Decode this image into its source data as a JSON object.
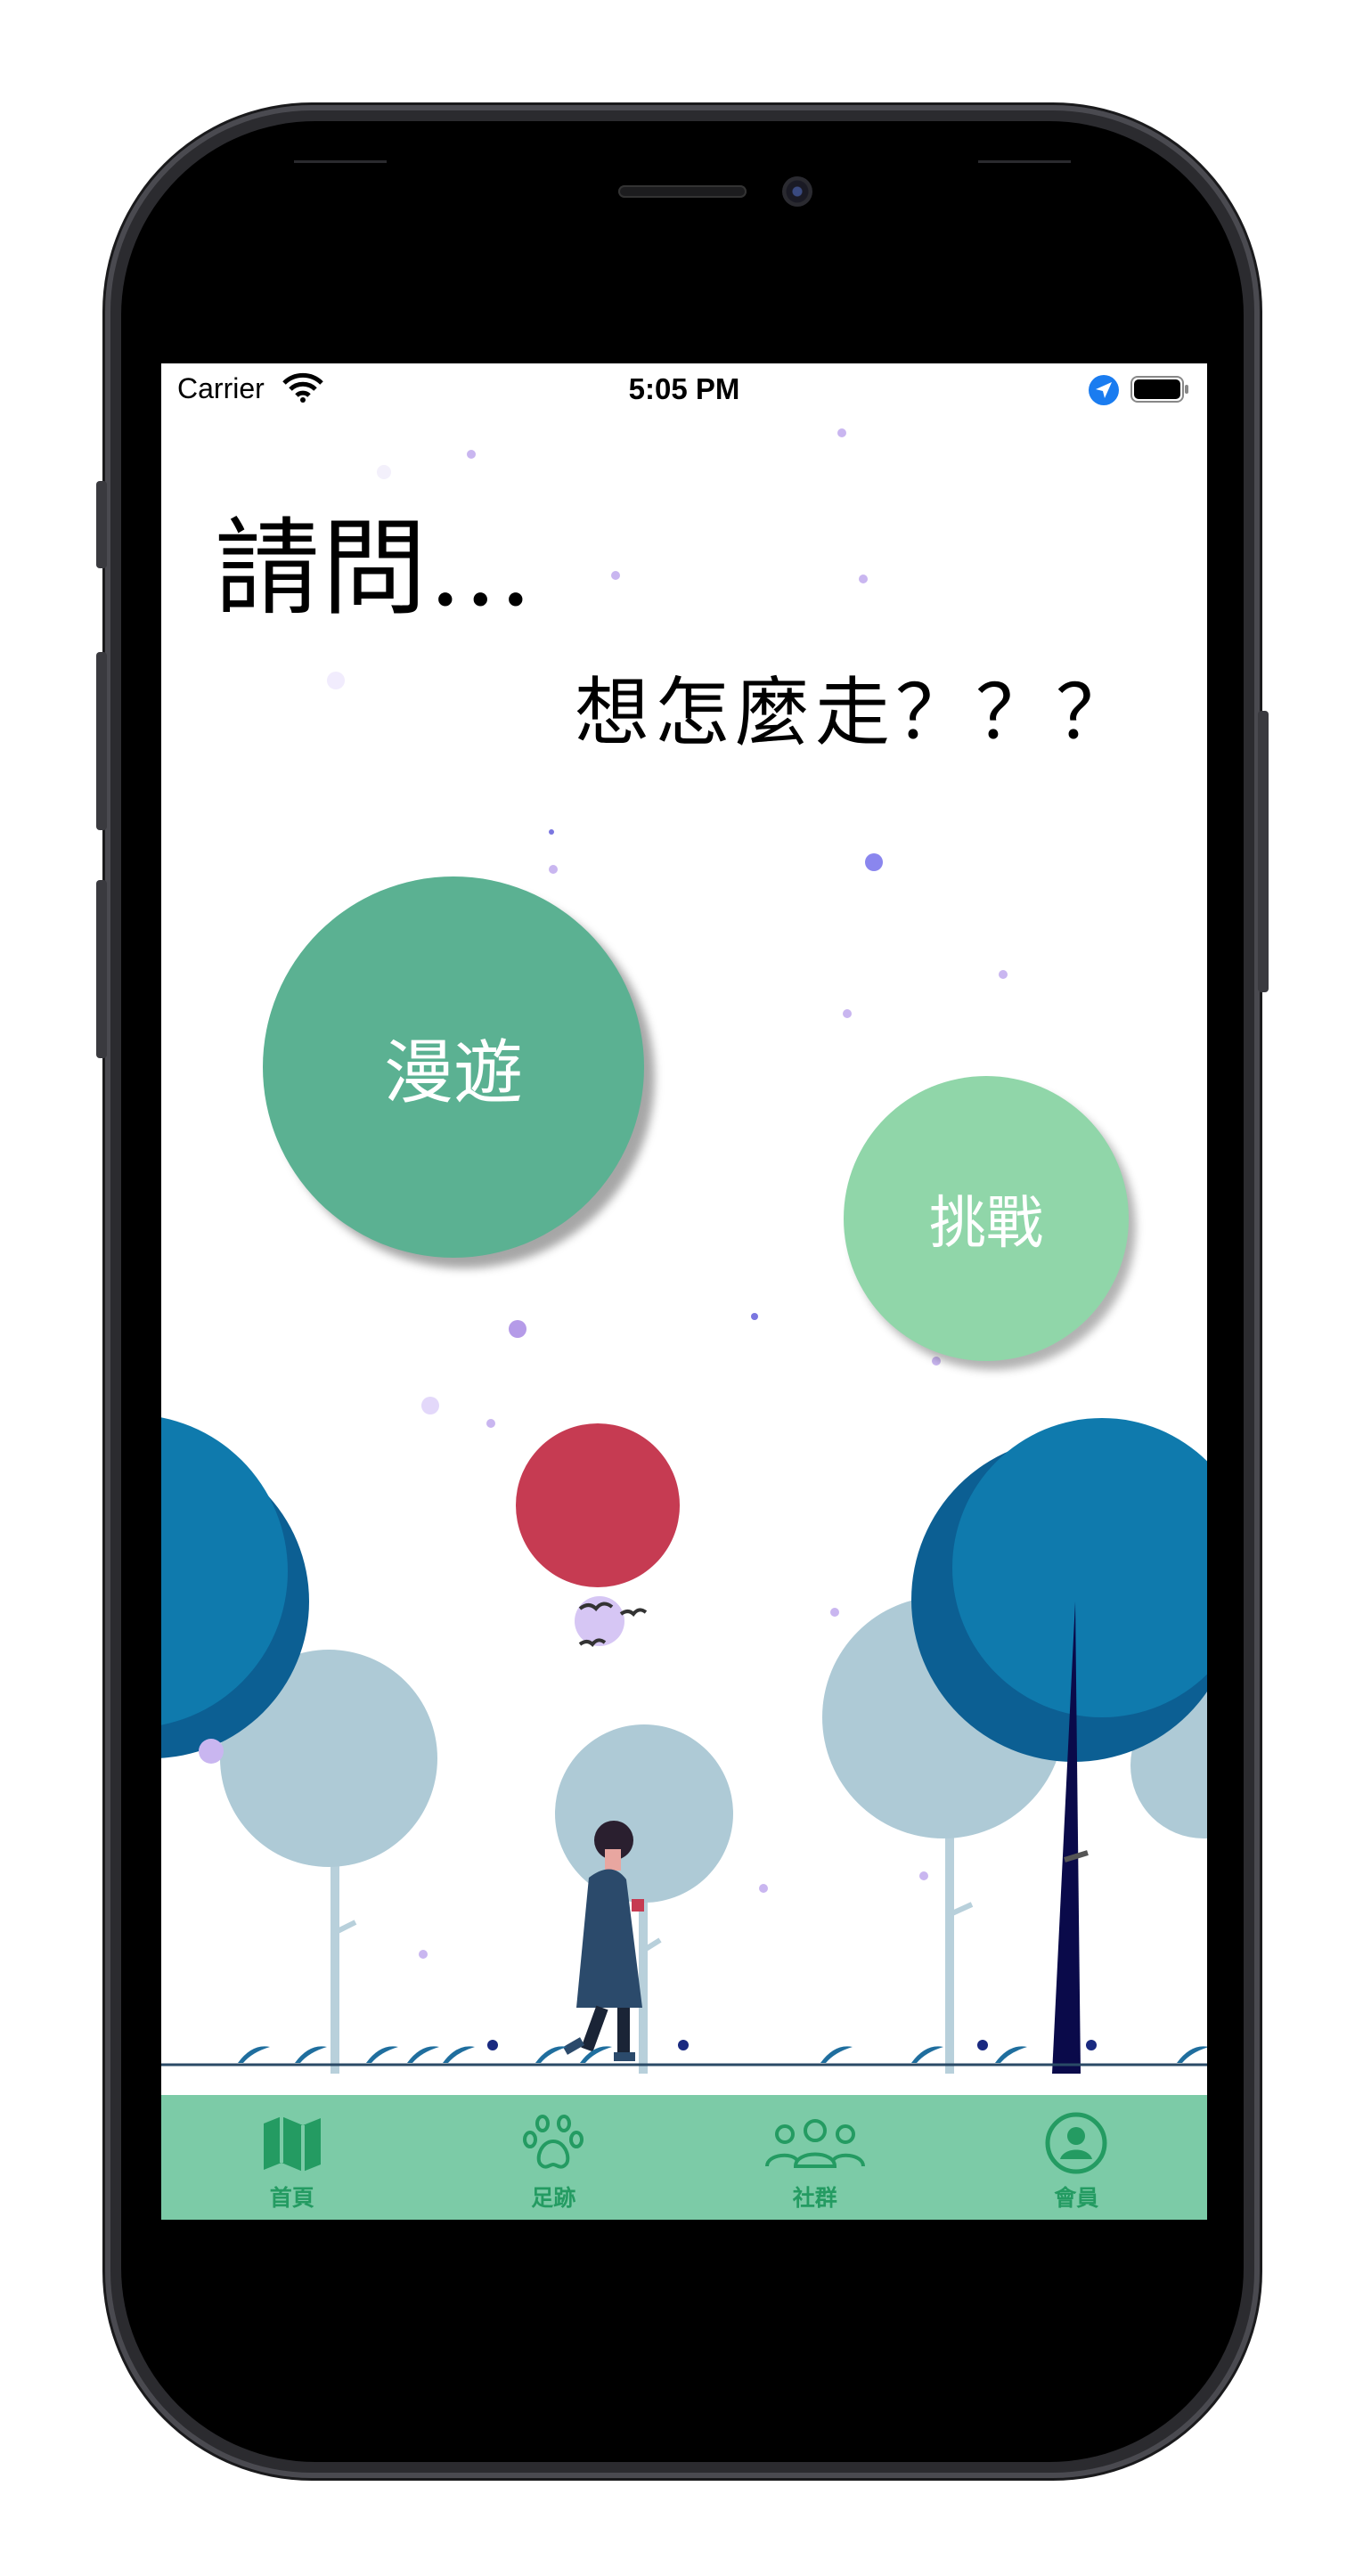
{
  "status_bar": {
    "carrier": "Carrier",
    "time": "5:05 PM"
  },
  "prompt": {
    "title": "請問...",
    "subtitle": "想怎麼走？？？"
  },
  "buttons": {
    "wander": "漫遊",
    "challenge": "挑戰"
  },
  "tab_bar": {
    "items": [
      {
        "label": "首頁",
        "icon": "map-icon"
      },
      {
        "label": "足跡",
        "icon": "paw-icon"
      },
      {
        "label": "社群",
        "icon": "group-icon"
      },
      {
        "label": "會員",
        "icon": "user-circle-icon"
      }
    ]
  },
  "colors": {
    "wander_button": "#5bb192",
    "challenge_button": "#90d6a9",
    "tab_bar": "#7ccba7",
    "tab_active": "#249b62",
    "balloon": "#c63b52",
    "tree_dark": "#0f7aad",
    "tree_light": "#aecad6"
  }
}
